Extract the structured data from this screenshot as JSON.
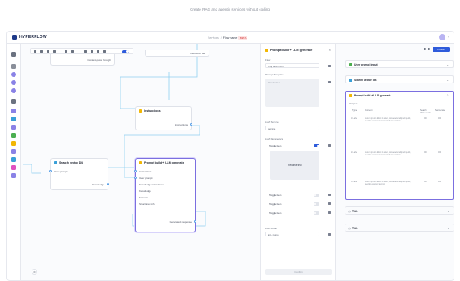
{
  "tagline": "Create RAG and agentic services without coding",
  "brand": {
    "name": "HYPERFLOW"
  },
  "breadcrumb": {
    "parent": "Services",
    "separator": "/",
    "current": "Flow name",
    "badge": "BETA"
  },
  "canvas": {
    "top_fragment_a": "Context-pass through",
    "top_fragment_b": "Instruction set",
    "nodes": {
      "instructions": {
        "title": "Instructions",
        "out": "Instructions"
      },
      "search": {
        "title": "Search vector DB",
        "row1": "User prompt",
        "out": "Knowledge"
      },
      "prompt": {
        "title": "Prompt build + LLM generate",
        "rows": [
          "Instructions",
          "User prompt",
          "Knowledge instructions",
          "Knowledge",
          "Formats",
          "Structured info"
        ],
        "out": "Generated response"
      }
    }
  },
  "config_panel": {
    "title": "Prompt build + LLM generate",
    "close": "×",
    "flow_label": "Flow",
    "flow_value": "Drop down item",
    "prompt_label": "Prompt Template",
    "prompt_placeholder": "Placeholder",
    "llm_label": "LLM Service",
    "llm_value": "Service",
    "params_label": "LLM Parameters",
    "toggles": [
      "Toggle item",
      "Toggle item",
      "Toggle item",
      "Toggle item"
    ],
    "relative_label": "Relative Inc",
    "model_label": "LLM Model",
    "model_value": "gpt-4 turbo",
    "confirm_label": "Confirm"
  },
  "right_panel": {
    "publish_label": "Publish",
    "cards": [
      {
        "title": "User prompt input",
        "color": "#4caf50"
      },
      {
        "title": "Search vector DB",
        "color": "#3aa0d8"
      },
      {
        "title": "Prompt build + LLM generate",
        "color": "#f2b705",
        "output_label": "Outputs"
      },
      {
        "title": "Title",
        "color": ""
      },
      {
        "title": "Title",
        "color": ""
      }
    ],
    "table": {
      "headers": [
        "Type",
        "Content",
        "Search Value result",
        "Source rate"
      ],
      "rows": [
        {
          "type": "1. Label",
          "content": "Lorem ipsum dolor sit amet, consectetur adipiscing elit, sed do eiusmod tempor incididunt ut labore",
          "val": "000",
          "rate": "000"
        },
        {
          "type": "2. Label",
          "content": "Lorem ipsum dolor sit amet, consectetur adipiscing elit, sed do eiusmod tempor incididunt ut labore",
          "val": "000",
          "rate": "000"
        },
        {
          "type": "3. Label",
          "content": "Lorem ipsum dolor sit amet, consectetur adipiscing elit, sed do eiusmod tempor",
          "val": "000",
          "rate": "000"
        }
      ]
    }
  }
}
